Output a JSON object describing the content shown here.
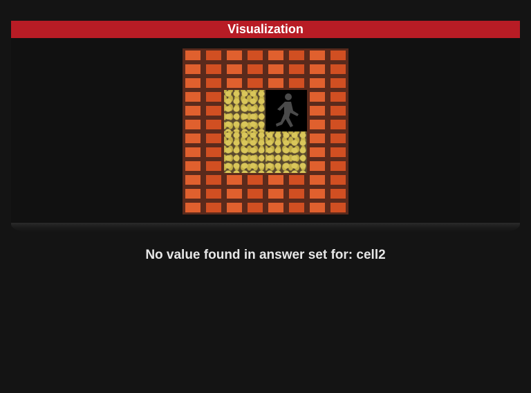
{
  "header": {
    "title": "Visualization"
  },
  "board": {
    "rows": 4,
    "cols": 4,
    "cells": [
      [
        "wall",
        "wall",
        "wall",
        "wall"
      ],
      [
        "wall",
        "floor",
        "person",
        "wall"
      ],
      [
        "wall",
        "floor",
        "floor",
        "wall"
      ],
      [
        "wall",
        "wall",
        "wall",
        "wall"
      ]
    ]
  },
  "icons": {
    "wall": "brick-wall-icon",
    "floor": "gravel-floor-icon",
    "person": "walking-person-icon"
  },
  "colors": {
    "header_bg": "#b81c25",
    "page_bg": "#141414",
    "brick": "#d8562a",
    "gravel": "#d9c65a"
  },
  "message": {
    "text": "No value found in answer set for: cell2"
  }
}
